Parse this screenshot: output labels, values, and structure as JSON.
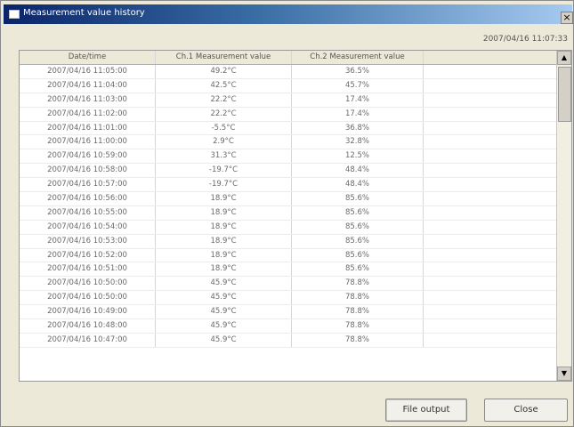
{
  "window": {
    "title": "Measurement value history",
    "close_glyph": "×"
  },
  "timestamp": "2007/04/16 11:07:33",
  "table": {
    "columns": [
      "Date/time",
      "Ch.1 Measurement value",
      "Ch.2 Measurement value",
      ""
    ],
    "rows": [
      [
        "2007/04/16 11:05:00",
        "49.2°C",
        "36.5%"
      ],
      [
        "2007/04/16 11:04:00",
        "42.5°C",
        "45.7%"
      ],
      [
        "2007/04/16 11:03:00",
        "22.2°C",
        "17.4%"
      ],
      [
        "2007/04/16 11:02:00",
        "22.2°C",
        "17.4%"
      ],
      [
        "2007/04/16 11:01:00",
        "-5.5°C",
        "36.8%"
      ],
      [
        "2007/04/16 11:00:00",
        "2.9°C",
        "32.8%"
      ],
      [
        "2007/04/16 10:59:00",
        "31.3°C",
        "12.5%"
      ],
      [
        "2007/04/16 10:58:00",
        "-19.7°C",
        "48.4%"
      ],
      [
        "2007/04/16 10:57:00",
        "-19.7°C",
        "48.4%"
      ],
      [
        "2007/04/16 10:56:00",
        "18.9°C",
        "85.6%"
      ],
      [
        "2007/04/16 10:55:00",
        "18.9°C",
        "85.6%"
      ],
      [
        "2007/04/16 10:54:00",
        "18.9°C",
        "85.6%"
      ],
      [
        "2007/04/16 10:53:00",
        "18.9°C",
        "85.6%"
      ],
      [
        "2007/04/16 10:52:00",
        "18.9°C",
        "85.6%"
      ],
      [
        "2007/04/16 10:51:00",
        "18.9°C",
        "85.6%"
      ],
      [
        "2007/04/16 10:50:00",
        "45.9°C",
        "78.8%"
      ],
      [
        "2007/04/16 10:50:00",
        "45.9°C",
        "78.8%"
      ],
      [
        "2007/04/16 10:49:00",
        "45.9°C",
        "78.8%"
      ],
      [
        "2007/04/16 10:48:00",
        "45.9°C",
        "78.8%"
      ],
      [
        "2007/04/16 10:47:00",
        "45.9°C",
        "78.8%"
      ]
    ]
  },
  "buttons": {
    "file_output": "File output",
    "close": "Close"
  },
  "icons": {
    "window_icon": "window-icon",
    "scroll_up": "▲",
    "scroll_down": "▼"
  }
}
